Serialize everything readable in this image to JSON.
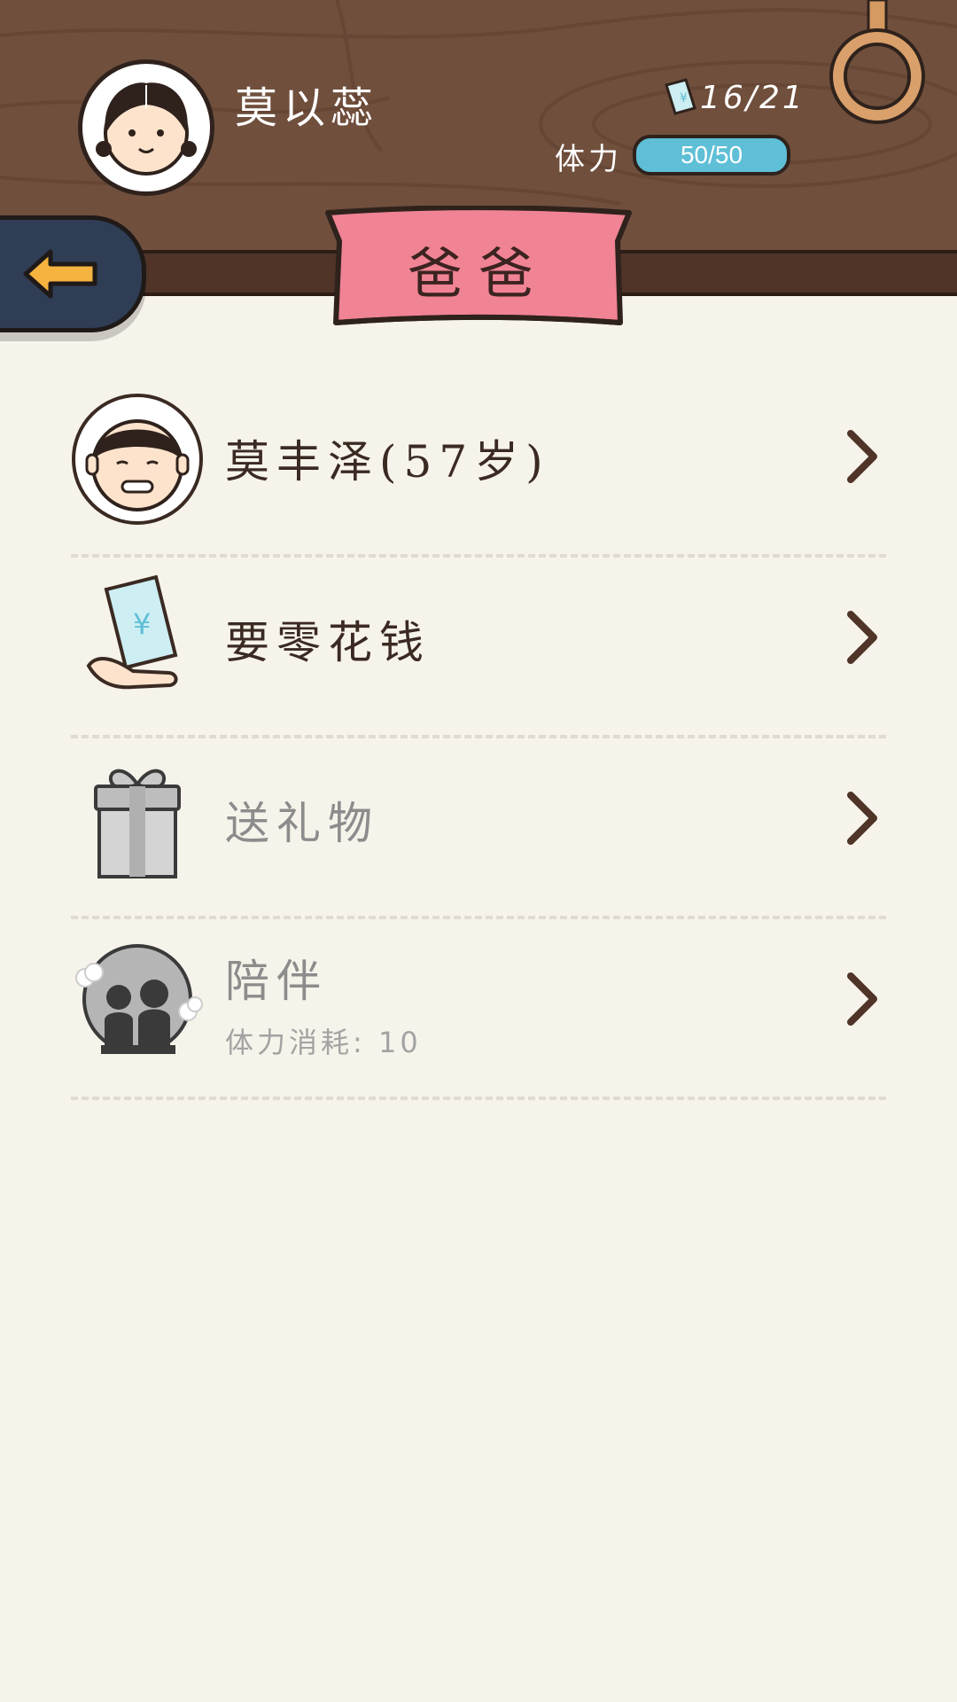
{
  "header": {
    "player_name": "莫以蕊",
    "money": "16/21",
    "stamina_label": "体力",
    "stamina_value": "50/50",
    "stamina_fraction": 1.0
  },
  "page_title": "爸爸",
  "list": [
    {
      "label": "莫丰泽(57岁)",
      "icon": "father-avatar-icon",
      "enabled": true
    },
    {
      "label": "要零花钱",
      "icon": "pocket-money-icon",
      "enabled": true
    },
    {
      "label": "送礼物",
      "icon": "gift-icon",
      "enabled": false
    },
    {
      "label": "陪伴",
      "sub": "体力消耗: 10",
      "icon": "companion-icon",
      "enabled": false
    }
  ],
  "colors": {
    "wood": "#704f3d",
    "background": "#f6f3ea",
    "ribbon": "#f08394",
    "stamina_bar": "#5ebfd6",
    "back_button": "#2f3d55",
    "back_arrow": "#f5b340"
  }
}
